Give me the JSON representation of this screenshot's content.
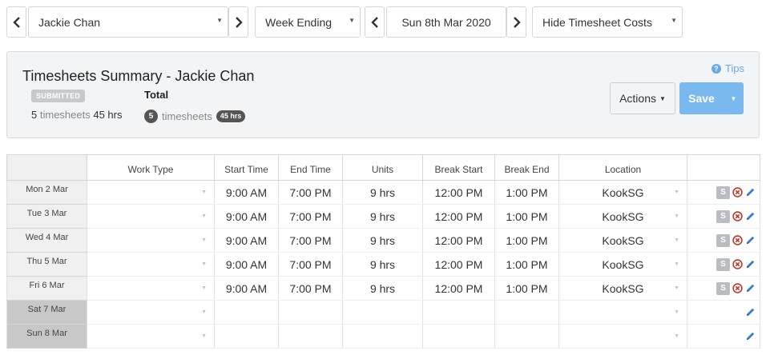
{
  "toolbar": {
    "employee": "Jackie Chan",
    "period_type": "Week Ending",
    "date": "Sun 8th Mar 2020",
    "cost_visibility": "Hide Timesheet Costs"
  },
  "summary": {
    "title": "Timesheets Summary - Jackie Chan",
    "status": "SUBMITTED",
    "timesheet_count": "5",
    "timesheets_word": "timesheets",
    "hours": "45 hrs",
    "total_label": "Total",
    "total_count": "5",
    "total_word": "timesheets",
    "total_hours": "45 hrs",
    "tips": "Tips",
    "actions_label": "Actions",
    "save_label": "Save"
  },
  "table": {
    "columns": [
      "",
      "Work Type",
      "Start Time",
      "End Time",
      "Units",
      "Break Start",
      "Break End",
      "Location",
      ""
    ],
    "rows": [
      {
        "day": "Mon 2 Mar",
        "start": "9:00 AM",
        "end": "7:00 PM",
        "units": "9 hrs",
        "break_start": "12:00 PM",
        "break_end": "1:00 PM",
        "location": "KookSG",
        "status_letter": "S"
      },
      {
        "day": "Tue 3 Mar",
        "start": "9:00 AM",
        "end": "7:00 PM",
        "units": "9 hrs",
        "break_start": "12:00 PM",
        "break_end": "1:00 PM",
        "location": "KookSG",
        "status_letter": "S"
      },
      {
        "day": "Wed 4 Mar",
        "start": "9:00 AM",
        "end": "7:00 PM",
        "units": "9 hrs",
        "break_start": "12:00 PM",
        "break_end": "1:00 PM",
        "location": "KookSG",
        "status_letter": "S"
      },
      {
        "day": "Thu 5 Mar",
        "start": "9:00 AM",
        "end": "7:00 PM",
        "units": "9 hrs",
        "break_start": "12:00 PM",
        "break_end": "1:00 PM",
        "location": "KookSG",
        "status_letter": "S"
      },
      {
        "day": "Fri 6 Mar",
        "start": "9:00 AM",
        "end": "7:00 PM",
        "units": "9 hrs",
        "break_start": "12:00 PM",
        "break_end": "1:00 PM",
        "location": "KookSG",
        "status_letter": "S"
      },
      {
        "day": "Sat 7 Mar",
        "start": "",
        "end": "",
        "units": "",
        "break_start": "",
        "break_end": "",
        "location": "",
        "status_letter": ""
      },
      {
        "day": "Sun 8 Mar",
        "start": "",
        "end": "",
        "units": "",
        "break_start": "",
        "break_end": "",
        "location": "",
        "status_letter": ""
      }
    ]
  },
  "colors": {
    "accent_blue": "#7ab8f0",
    "delete_red": "#c0392b",
    "edit_blue": "#3a7bd5",
    "weekend_day_bg": "#c8c8c8"
  },
  "icons": {
    "prev": "chevron-left-icon",
    "next": "chevron-right-icon",
    "delete": "remove-circle-icon",
    "edit": "pencil-icon",
    "help": "question-circle-icon"
  }
}
